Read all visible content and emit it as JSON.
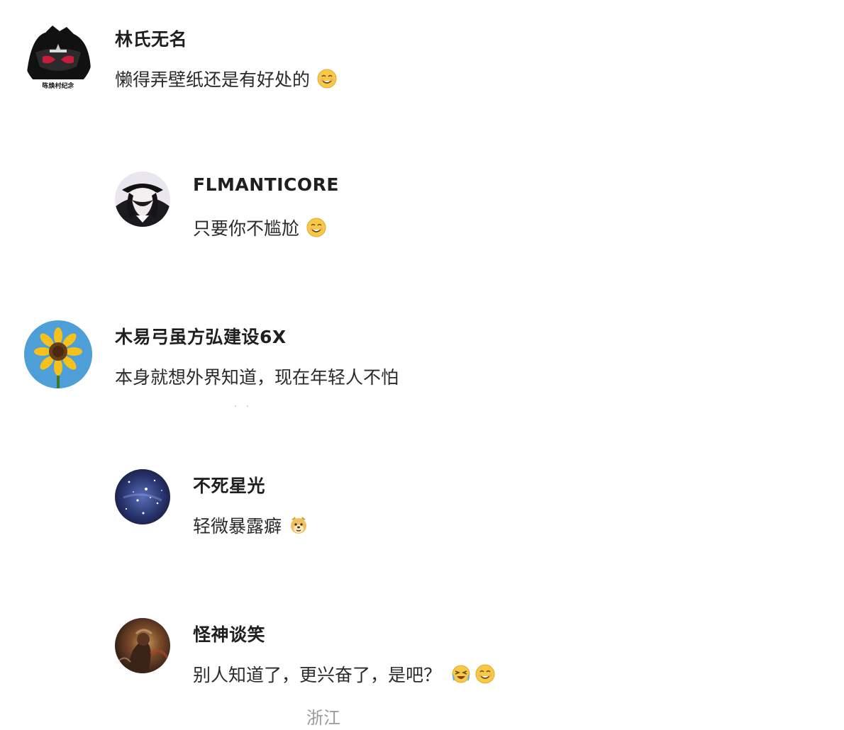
{
  "comments": [
    {
      "username": "林氏无名",
      "text": "懒得弄壁纸还是有好处的",
      "emojis": [
        "smile-emoji"
      ],
      "avatar": "mask-avatar",
      "avatar_text": "陈焕村纪念"
    },
    {
      "username": "FLMANTICORE",
      "text": "只要你不尴尬",
      "emojis": [
        "smile-emoji"
      ],
      "avatar": "anime-hat-avatar"
    },
    {
      "username": "木易弓虽方弘建设6X",
      "text": "本身就想外界知道，现在年轻人不怕",
      "emojis": [],
      "avatar": "sunflower-avatar"
    },
    {
      "username": "不死星光",
      "text": "轻微暴露癖",
      "emojis": [
        "doge-emoji"
      ],
      "avatar": "starry-avatar"
    },
    {
      "username": "怪神谈笑",
      "text": "别人知道了，更兴奋了，是吧？",
      "emojis": [
        "laugh-cry-emoji",
        "smile-emoji"
      ],
      "avatar": "dark-art-avatar"
    }
  ],
  "location": "浙江",
  "colors": {
    "background": "#ffffff",
    "username": "#1f1f1f",
    "text": "#2a2a2a",
    "location": "#9a9a9a",
    "emoji_yellow": "#f7c948"
  }
}
